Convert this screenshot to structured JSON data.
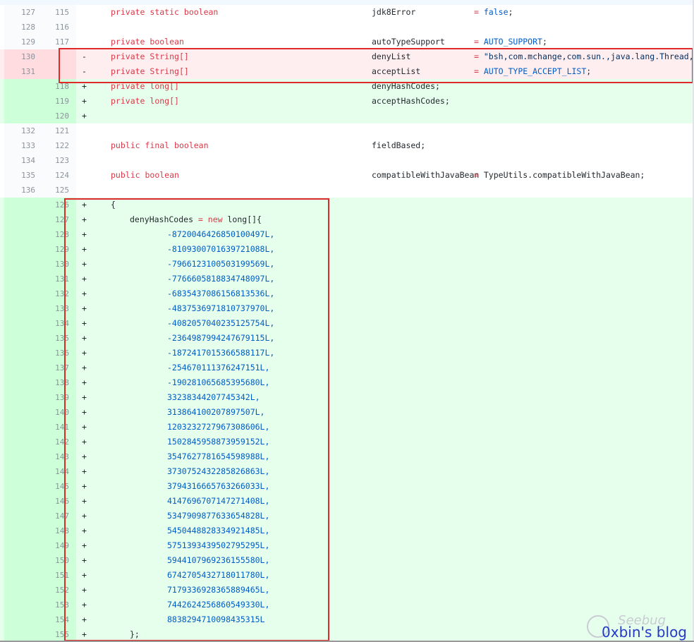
{
  "rows": [
    {
      "old": "127",
      "new": "115",
      "sign": "",
      "kind": "ctx",
      "a": "private static boolean",
      "b": "jdk8Error",
      "c": "= false;"
    },
    {
      "old": "128",
      "new": "116",
      "sign": "",
      "kind": "ctx",
      "a": "",
      "b": "",
      "c": ""
    },
    {
      "old": "129",
      "new": "117",
      "sign": "",
      "kind": "ctx",
      "a": "private boolean",
      "b": "autoTypeSupport",
      "c": "= AUTO_SUPPORT;"
    },
    {
      "old": "130",
      "new": "",
      "sign": "-",
      "kind": "del",
      "a": "private String[]",
      "b": "denyList",
      "c": "= \"bsh,com.mchange,com.sun.,java.lang.Thread,ja"
    },
    {
      "old": "131",
      "new": "",
      "sign": "-",
      "kind": "del",
      "a": "private String[]",
      "b": "acceptList",
      "c": "= AUTO_TYPE_ACCEPT_LIST;"
    },
    {
      "old": "",
      "new": "118",
      "sign": "+",
      "kind": "add",
      "a": "private long[]",
      "b": "denyHashCodes;",
      "c": ""
    },
    {
      "old": "",
      "new": "119",
      "sign": "+",
      "kind": "add",
      "a": "private long[]",
      "b": "acceptHashCodes;",
      "c": ""
    },
    {
      "old": "",
      "new": "120",
      "sign": "+",
      "kind": "add",
      "a": "",
      "b": "",
      "c": ""
    },
    {
      "old": "132",
      "new": "121",
      "sign": "",
      "kind": "ctx",
      "a": "",
      "b": "",
      "c": ""
    },
    {
      "old": "133",
      "new": "122",
      "sign": "",
      "kind": "ctx",
      "a": "public final boolean",
      "b": "fieldBased;",
      "c": ""
    },
    {
      "old": "134",
      "new": "123",
      "sign": "",
      "kind": "ctx",
      "a": "",
      "b": "",
      "c": ""
    },
    {
      "old": "135",
      "new": "124",
      "sign": "",
      "kind": "ctx",
      "a": "public boolean",
      "b": "compatibleWithJavaBean",
      "c": "= TypeUtils.compatibleWithJavaBean;"
    },
    {
      "old": "136",
      "new": "125",
      "sign": "",
      "kind": "ctx",
      "a": "",
      "b": "",
      "c": ""
    }
  ],
  "block": {
    "new_start": 126,
    "open": "{",
    "decl_name": "denyHashCodes",
    "decl_eq": " = ",
    "decl_new": "new",
    "decl_rest": " long[]{",
    "values": [
      "-8720046426850100497L,",
      "-8109300701639721088L,",
      "-7966123100503199569L,",
      "-7766605818834748097L,",
      "-6835437086156813536L,",
      "-4837536971810737970L,",
      "-4082057040235125754L,",
      "-2364987994247679115L,",
      "-1872417015366588117L,",
      "-254670111376247151L,",
      "-190281065685395680L,",
      "33238344207745342L,",
      "313864100207897507L,",
      "1203232727967308606L,",
      "1502845958873959152L,",
      "3547627781654598988L,",
      "3730752432285826863L,",
      "3794316665763266033L,",
      "4147696707147271408L,",
      "5347909877633654828L,",
      "5450448828334921485L,",
      "5751393439502795295L,",
      "5944107969236155580L,",
      "6742705432718011780L,",
      "7179336928365889465L,",
      "7442624256860549330L,",
      "8838294710098435315L"
    ],
    "close": "};"
  },
  "watermark": {
    "text": "0xbin's blog",
    "seebug": "Seebug"
  },
  "colors": {
    "keyword": "#d73a49",
    "constant": "#005cc5",
    "highlight_box": "#e02a2a",
    "add_bg": "#e6ffed",
    "del_bg": "#ffeef0"
  }
}
